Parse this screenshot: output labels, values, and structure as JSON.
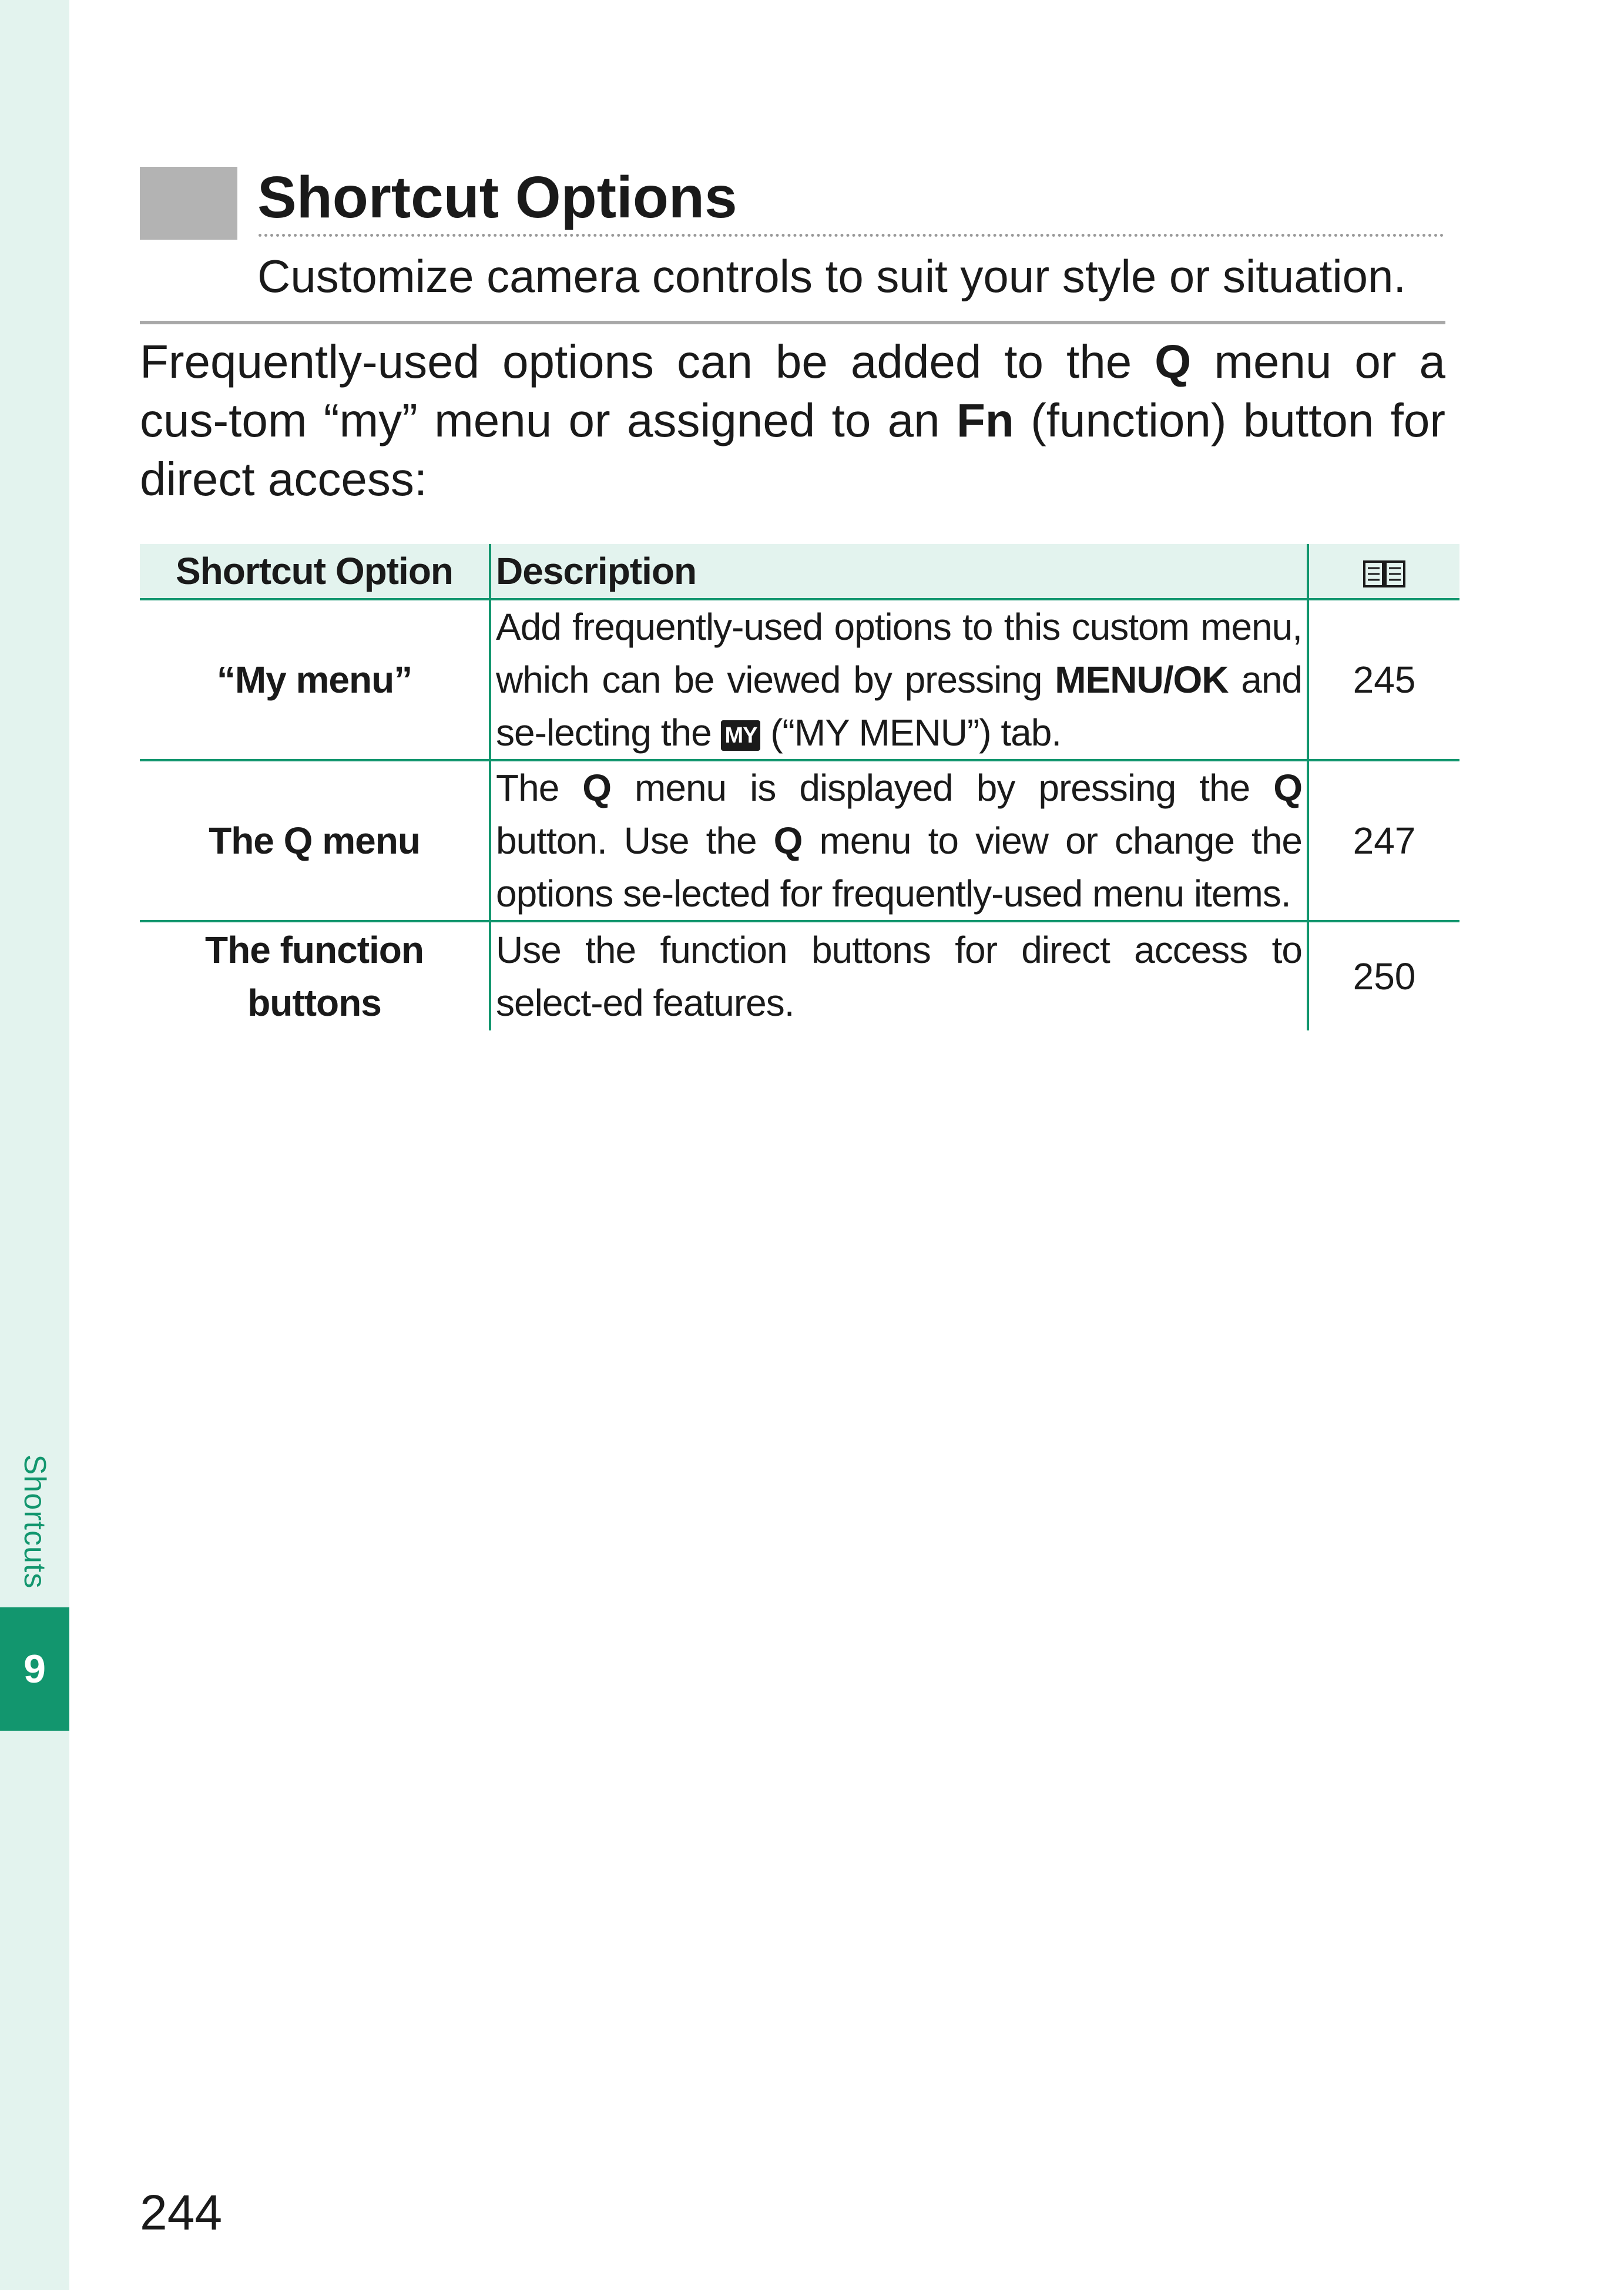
{
  "sidebar": {
    "chapter_label": "Shortcuts",
    "chapter_number": "9",
    "accent_color": "#12966e",
    "strip_color": "#e3f3ee"
  },
  "section": {
    "title": "Shortcut Options",
    "subtitle": "Customize camera controls to suit your style or situation."
  },
  "intro": {
    "part1": "Frequently-used options can be added to the ",
    "q": "Q",
    "part2": " menu or a cus-tom “my” menu or assigned to an ",
    "fn": "Fn",
    "part3": " (function) button for direct access:"
  },
  "table": {
    "headers": {
      "option": "Shortcut Option",
      "description": "Description",
      "page_icon": "book-page-reference-icon"
    },
    "rows": [
      {
        "option": "“My menu”",
        "desc_a": "Add frequently-used options to this custom menu, which can be viewed by pressing ",
        "desc_b": "MENU/OK",
        "desc_c": " and se-lecting the ",
        "desc_icon": "MY",
        "desc_d": " (“MY MENU”) tab.",
        "page": "245"
      },
      {
        "option": "The Q menu",
        "desc_a": "The ",
        "desc_b": "Q",
        "desc_c": " menu is displayed by pressing the ",
        "desc_d": "Q",
        "desc_e": " button. Use the ",
        "desc_f": "Q",
        "desc_g": " menu to view or change the options se-lected for frequently-used menu items.",
        "page": "247"
      },
      {
        "option": "The function buttons",
        "desc_a": "Use the function buttons for direct access to select-ed features.",
        "page": "250"
      }
    ]
  },
  "footer": {
    "page_number": "244"
  }
}
